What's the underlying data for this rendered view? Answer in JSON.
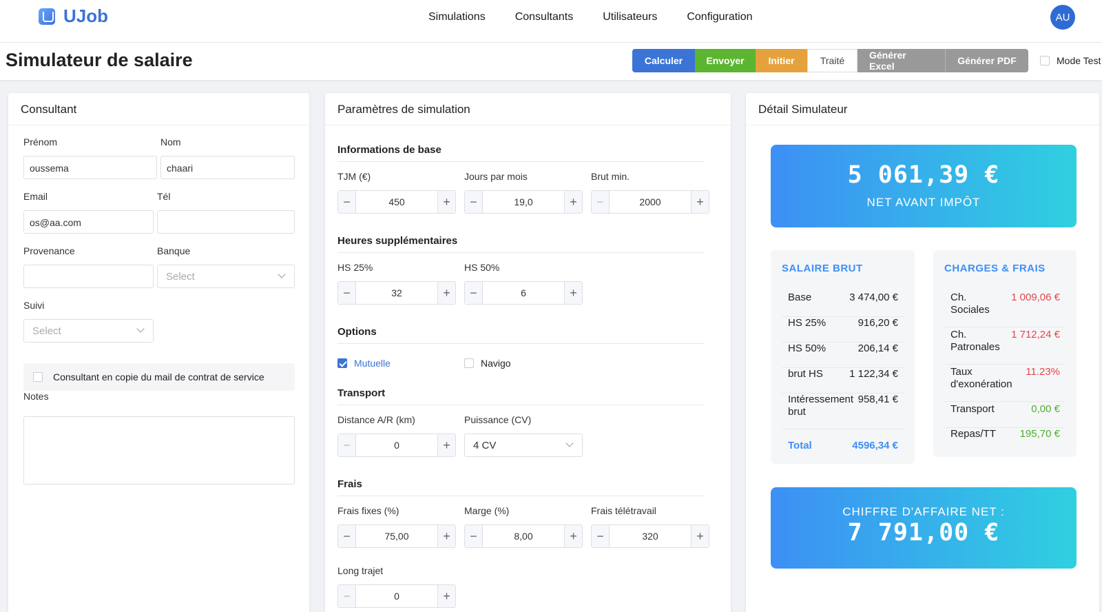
{
  "app": {
    "name": "UJob",
    "avatar_initials": "AU"
  },
  "nav": {
    "items": [
      "Simulations",
      "Consultants",
      "Utilisateurs",
      "Configuration"
    ]
  },
  "page": {
    "title": "Simulateur de salaire"
  },
  "actions": {
    "calculer": "Calculer",
    "envoyer": "Envoyer",
    "initier": "Initier",
    "traite": "Traité",
    "excel": "Générer Excel",
    "pdf": "Générer PDF",
    "mode_test": "Mode Test"
  },
  "consultant": {
    "title": "Consultant",
    "prenom_label": "Prénom",
    "prenom": "oussema",
    "nom_label": "Nom",
    "nom": "chaari",
    "email_label": "Email",
    "email": "os@aa.com",
    "tel_label": "Tél",
    "tel": "",
    "provenance_label": "Provenance",
    "provenance": "",
    "banque_label": "Banque",
    "banque_placeholder": "Select",
    "suivi_label": "Suivi",
    "suivi_placeholder": "Select",
    "copie_label": "Consultant en copie du mail de contrat de service",
    "notes_label": "Notes"
  },
  "params": {
    "title": "Paramètres de simulation",
    "base_title": "Informations de base",
    "tjm_label": "TJM (€)",
    "tjm": "450",
    "jours_label": "Jours par mois",
    "jours": "19,0",
    "brutmin_label": "Brut min.",
    "brutmin": "2000",
    "hs_title": "Heures supplémentaires",
    "hs25_label": "HS 25%",
    "hs25": "32",
    "hs50_label": "HS 50%",
    "hs50": "6",
    "options_title": "Options",
    "mutuelle": "Mutuelle",
    "mutuelle_checked": true,
    "navigo": "Navigo",
    "navigo_checked": false,
    "transport_title": "Transport",
    "distance_label": "Distance A/R (km)",
    "distance": "0",
    "puissance_label": "Puissance (CV)",
    "puissance": "4 CV",
    "frais_title": "Frais",
    "fraisfixes_label": "Frais fixes (%)",
    "fraisfixes": "75,00",
    "marge_label": "Marge (%)",
    "marge": "8,00",
    "teletravail_label": "Frais télétravail",
    "teletravail": "320",
    "longtrajet_label": "Long trajet",
    "longtrajet": "0"
  },
  "detail": {
    "title": "Détail Simulateur",
    "net_amount": "5 061,39 €",
    "net_caption": "NET AVANT IMPÔT",
    "brut_title": "SALAIRE BRUT",
    "brut_rows": [
      {
        "k": "Base",
        "v": "3 474,00 €"
      },
      {
        "k": "HS 25%",
        "v": "916,20 €"
      },
      {
        "k": "HS 50%",
        "v": "206,14 €"
      },
      {
        "k": "brut HS",
        "v": "1 122,34 €"
      },
      {
        "k": "Intéressement brut",
        "v": "958,41 €"
      }
    ],
    "brut_total_label": "Total",
    "brut_total": "4596,34 €",
    "charges_title": "CHARGES & FRAIS",
    "charges_rows": [
      {
        "k": "Ch. Sociales",
        "v": "1 009,06 €"
      },
      {
        "k": "Ch. Patronales",
        "v": "1 712,24 €"
      },
      {
        "k": "Taux d'exonération",
        "v": "11.23%"
      },
      {
        "k": "Transport",
        "v": "0,00 €"
      },
      {
        "k": "Repas/TT",
        "v": "195,70 €"
      }
    ],
    "ca_caption": "CHIFFRE D'AFFAIRE NET :",
    "ca_amount": "7 791,00 €"
  },
  "colors": {
    "accent": "#3b74d6",
    "green": "#5cb531",
    "orange": "#e5a23c",
    "grey": "#999999",
    "red": "#e2474a",
    "cyan": "#2fd0e0"
  }
}
